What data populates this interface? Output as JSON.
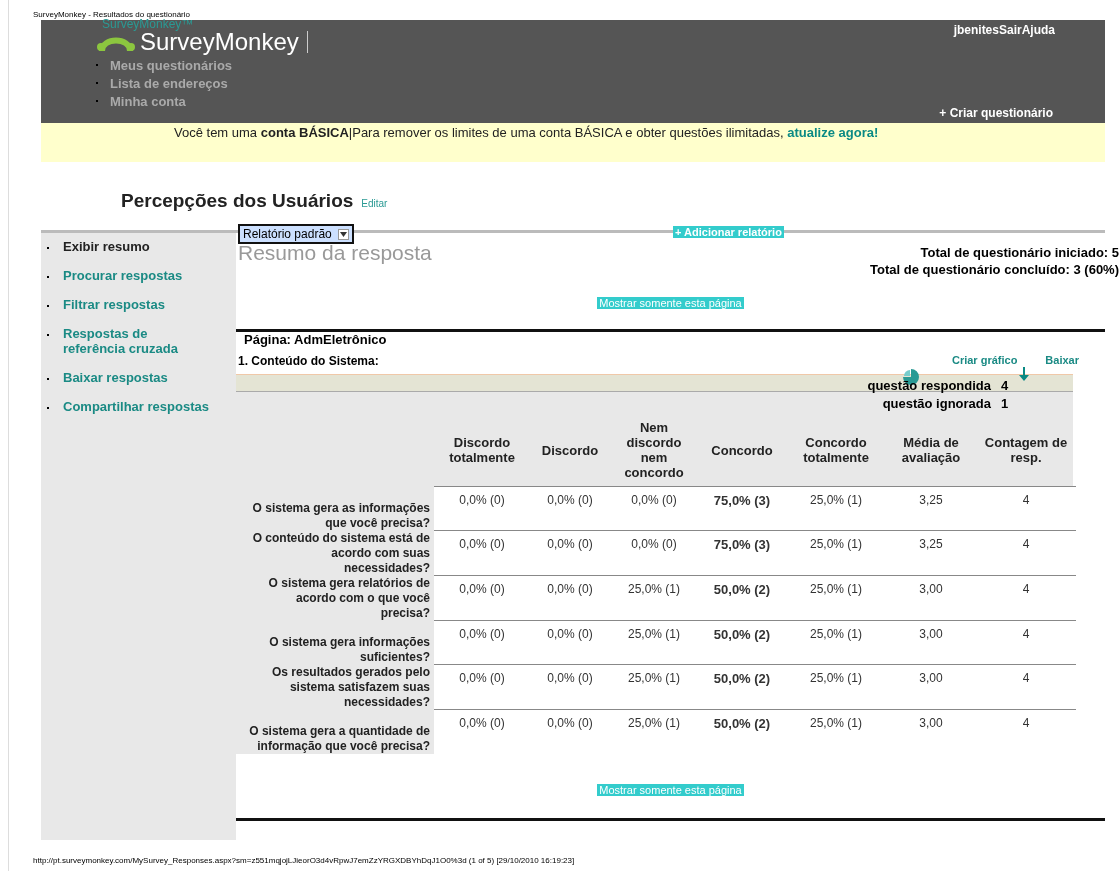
{
  "print_title": "SurveyMonkey - Resultados do questionário",
  "header": {
    "logo_alt": "SurveyMonkey™",
    "logo": "SurveyMonkey",
    "user_links": "jbenitesSairAjuda",
    "nav": [
      "Meus questionários",
      "Lista de endereços",
      "Minha conta"
    ],
    "create_link": "+ Criar questionário"
  },
  "banner": {
    "text": "Você tem uma **conta BÁSICA**|Para remover os limites de uma conta BÁSICA e obter questões ilimitadas,",
    "link": "atualize agora!"
  },
  "survey": {
    "title": "Percepções dos Usuários",
    "edit": "Editar"
  },
  "sidebar": [
    {
      "label": "Exibir resumo",
      "selected": true
    },
    {
      "label": "Procurar respostas",
      "selected": false
    },
    {
      "label": "Filtrar respostas",
      "selected": false
    },
    {
      "label": "Respostas de referência cruzada",
      "selected": false
    },
    {
      "label": "Baixar respostas",
      "selected": false
    },
    {
      "label": "Compartilhar respostas",
      "selected": false
    }
  ],
  "report_select": {
    "value": "Relatório padrão"
  },
  "add_report": "+ Adicionar relatório",
  "summary_title": "Resumo da resposta",
  "totals": [
    "Total de questionário iniciado: 5",
    "Total de questionário concluído: 3  (60%)"
  ],
  "show_page_button": "Mostrar somente esta página",
  "page_label": "Página: AdmEletrônico",
  "question": {
    "title": "1. Conteúdo do Sistema:",
    "create_chart": "Criar gráfico",
    "download": "Baixar",
    "answered_label": "questão respondida",
    "answered": "4",
    "skipped_label": "questão ignorada",
    "skipped": "1",
    "columns": [
      "Discordo totalmente",
      "Discordo",
      "Nem discordo nem concordo",
      "Concordo",
      "Concordo totalmente",
      "Média de avaliação",
      "Contagem de resp."
    ],
    "rows": [
      {
        "question": "O sistema gera as informações que você precisa?",
        "cells": [
          {
            "text": "0,0% (0)",
            "bold": false
          },
          {
            "text": "0,0% (0)",
            "bold": false
          },
          {
            "text": "0,0% (0)",
            "bold": false
          },
          {
            "text": "75,0% (3)",
            "bold": true
          },
          {
            "text": "25,0% (1)",
            "bold": false
          },
          {
            "text": "3,25",
            "bold": false
          },
          {
            "text": "4",
            "bold": false
          }
        ]
      },
      {
        "question": "O conteúdo do sistema está de acordo com suas necessidades?",
        "cells": [
          {
            "text": "0,0% (0)",
            "bold": false
          },
          {
            "text": "0,0% (0)",
            "bold": false
          },
          {
            "text": "0,0% (0)",
            "bold": false
          },
          {
            "text": "75,0% (3)",
            "bold": true
          },
          {
            "text": "25,0% (1)",
            "bold": false
          },
          {
            "text": "3,25",
            "bold": false
          },
          {
            "text": "4",
            "bold": false
          }
        ]
      },
      {
        "question": "O sistema gera relatórios de acordo com o que você precisa?",
        "cells": [
          {
            "text": "0,0% (0)",
            "bold": false
          },
          {
            "text": "0,0% (0)",
            "bold": false
          },
          {
            "text": "25,0% (1)",
            "bold": false
          },
          {
            "text": "50,0% (2)",
            "bold": true
          },
          {
            "text": "25,0% (1)",
            "bold": false
          },
          {
            "text": "3,00",
            "bold": false
          },
          {
            "text": "4",
            "bold": false
          }
        ]
      },
      {
        "question": "O sistema gera informações suficientes?",
        "cells": [
          {
            "text": "0,0% (0)",
            "bold": false
          },
          {
            "text": "0,0% (0)",
            "bold": false
          },
          {
            "text": "25,0% (1)",
            "bold": false
          },
          {
            "text": "50,0% (2)",
            "bold": true
          },
          {
            "text": "25,0% (1)",
            "bold": false
          },
          {
            "text": "3,00",
            "bold": false
          },
          {
            "text": "4",
            "bold": false
          }
        ]
      },
      {
        "question": "Os resultados gerados pelo sistema satisfazem suas necessidades?",
        "cells": [
          {
            "text": "0,0% (0)",
            "bold": false
          },
          {
            "text": "0,0% (0)",
            "bold": false
          },
          {
            "text": "25,0% (1)",
            "bold": false
          },
          {
            "text": "50,0% (2)",
            "bold": true
          },
          {
            "text": "25,0% (1)",
            "bold": false
          },
          {
            "text": "3,00",
            "bold": false
          },
          {
            "text": "4",
            "bold": false
          }
        ]
      },
      {
        "question": "O sistema gera a quantidade de informação que você precisa?",
        "cells": [
          {
            "text": "0,0% (0)",
            "bold": false
          },
          {
            "text": "0,0% (0)",
            "bold": false
          },
          {
            "text": "25,0% (1)",
            "bold": false
          },
          {
            "text": "50,0% (2)",
            "bold": true
          },
          {
            "text": "25,0% (1)",
            "bold": false
          },
          {
            "text": "3,00",
            "bold": false
          },
          {
            "text": "4",
            "bold": false
          }
        ]
      }
    ]
  },
  "show_page_button_bottom": "Mostrar somente esta página",
  "print_footer": "http://pt.surveymonkey.com/MySurvey_Responses.aspx?sm=z551mqjojLJieorO3d4vRpwJ7emZzYRGXDBYhDqJ1O0%3d (1 of 5) [29/10/2010 16:19:23]"
}
